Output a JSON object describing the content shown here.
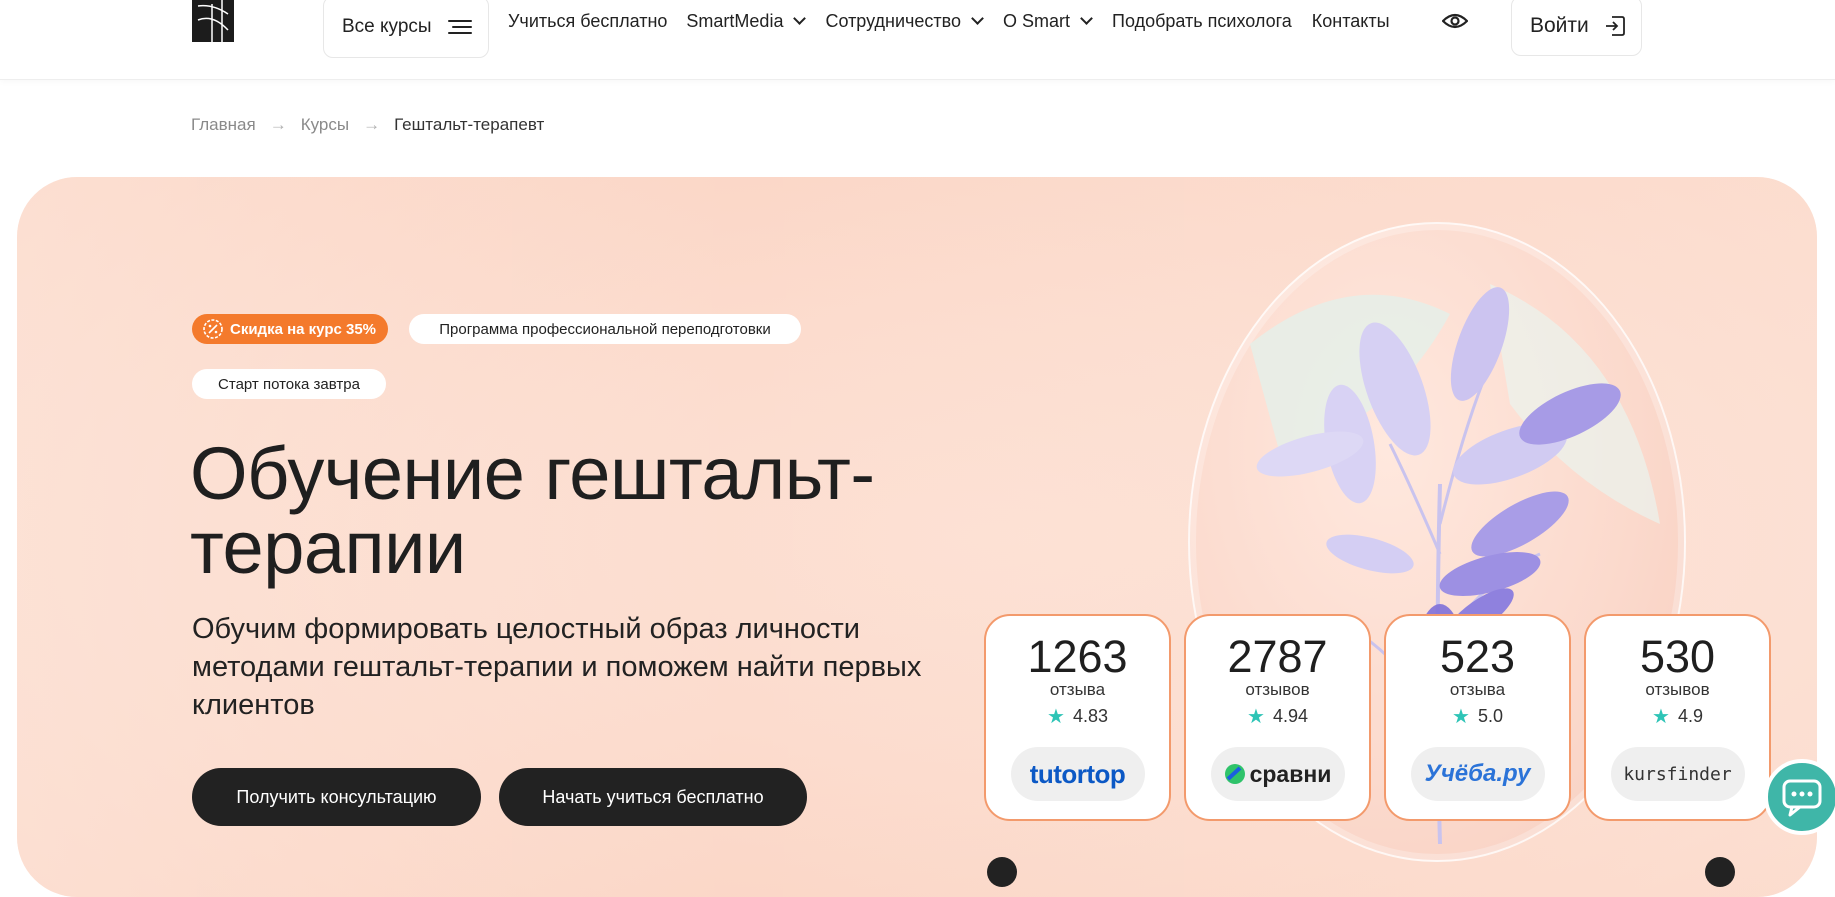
{
  "header": {
    "all_courses": "Все курсы",
    "nav": [
      "Учиться бесплатно",
      "SmartMedia",
      "Сотрудничество",
      "О Smart",
      "Подобрать психолога",
      "Контакты"
    ],
    "login": "Войти"
  },
  "breadcrumbs": {
    "home": "Главная",
    "courses": "Курсы",
    "current": "Гештальт-терапевт",
    "separator": "→"
  },
  "hero": {
    "badge_discount": "Скидка на курс 35%",
    "badge_program": "Программа профессиональной переподготовки",
    "badge_start": "Старт потока завтра",
    "title": "Обучение гештальт-терапии",
    "subtitle": "Обучим формировать целостный образ личности методами гештальт-терапии и поможем найти первых клиентов",
    "btn_consult": "Получить консультацию",
    "btn_free": "Начать учиться бесплатно"
  },
  "reviews": [
    {
      "count": "1263",
      "label": "отзыва",
      "rating": "4.83",
      "source": "tutortop"
    },
    {
      "count": "2787",
      "label": "отзывов",
      "rating": "4.94",
      "source": "сравни"
    },
    {
      "count": "523",
      "label": "отзыва",
      "rating": "5.0",
      "source": "Учёба.ру"
    },
    {
      "count": "530",
      "label": "отзывов",
      "rating": "4.9",
      "source": "kursfinder"
    }
  ],
  "colors": {
    "accent": "#f47a2c",
    "card_border": "#f39a6c",
    "star": "#2ec4b6",
    "chat": "#3fb6a8",
    "hero_bg": "#fcdcce"
  },
  "icons": {
    "rating": "star-icon",
    "chat": "chat-icon",
    "accessibility": "eye-icon",
    "login": "login-icon",
    "menu": "menu-icon"
  }
}
